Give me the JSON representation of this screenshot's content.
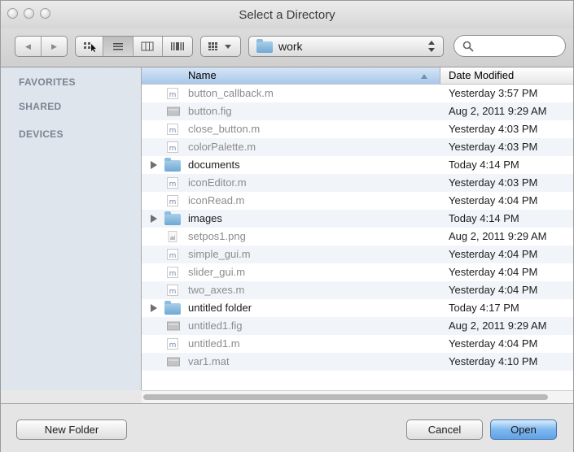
{
  "window": {
    "title": "Select a Directory"
  },
  "toolbar": {
    "back_glyph": "◀",
    "forward_glyph": "▶",
    "location": "work",
    "search_placeholder": ""
  },
  "sidebar": {
    "items": [
      {
        "label": "FAVORITES"
      },
      {
        "label": "SHARED"
      },
      {
        "label": "DEVICES"
      }
    ]
  },
  "columns": {
    "name": "Name",
    "date": "Date Modified"
  },
  "files": [
    {
      "name": "button_callback.m",
      "date": "Yesterday 3:57 PM",
      "kind": "m"
    },
    {
      "name": "button.fig",
      "date": "Aug 2, 2011 9:29 AM",
      "kind": "fig"
    },
    {
      "name": "close_button.m",
      "date": "Yesterday 4:03 PM",
      "kind": "m"
    },
    {
      "name": "colorPalette.m",
      "date": "Yesterday 4:03 PM",
      "kind": "m"
    },
    {
      "name": "documents",
      "date": "Today 4:14 PM",
      "kind": "folder"
    },
    {
      "name": "iconEditor.m",
      "date": "Yesterday 4:03 PM",
      "kind": "m"
    },
    {
      "name": "iconRead.m",
      "date": "Yesterday 4:04 PM",
      "kind": "m"
    },
    {
      "name": "images",
      "date": "Today 4:14 PM",
      "kind": "folder"
    },
    {
      "name": "setpos1.png",
      "date": "Aug 2, 2011 9:29 AM",
      "kind": "png"
    },
    {
      "name": "simple_gui.m",
      "date": "Yesterday 4:04 PM",
      "kind": "m"
    },
    {
      "name": "slider_gui.m",
      "date": "Yesterday 4:04 PM",
      "kind": "m"
    },
    {
      "name": "two_axes.m",
      "date": "Yesterday 4:04 PM",
      "kind": "m"
    },
    {
      "name": "untitled folder",
      "date": "Today 4:17 PM",
      "kind": "folder"
    },
    {
      "name": "untitled1.fig",
      "date": "Aug 2, 2011 9:29 AM",
      "kind": "fig"
    },
    {
      "name": "untitled1.m",
      "date": "Yesterday 4:04 PM",
      "kind": "m"
    },
    {
      "name": "var1.mat",
      "date": "Yesterday 4:10 PM",
      "kind": "mat"
    }
  ],
  "buttons": {
    "new_folder": "New Folder",
    "cancel": "Cancel",
    "open": "Open"
  },
  "colors": {
    "sidebar_bg": "#dfe5ec",
    "header_selected": "#a9c8ea",
    "open_button": "#5fa2e6",
    "folder": "#6fa8d4"
  }
}
